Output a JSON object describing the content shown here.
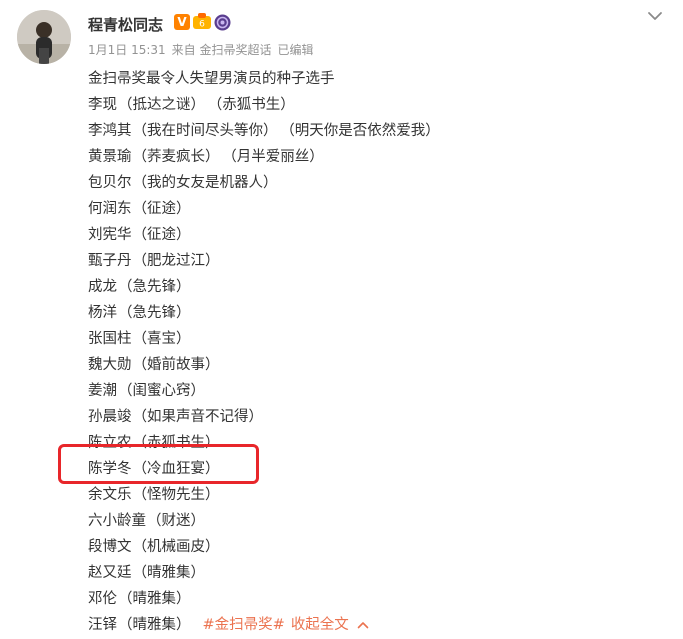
{
  "post": {
    "author": "程青松同志",
    "meta": {
      "date": "1月1日 15:31",
      "source": "来自 金扫帚奖超话",
      "edited": "已编辑"
    },
    "headline": "金扫帚奖最令人失望男演员的种子选手",
    "nominees": [
      {
        "name": "李现",
        "works": [
          "（抵达之谜）",
          "（赤狐书生）"
        ]
      },
      {
        "name": "李鸿其",
        "works": [
          "（我在时间尽头等你）",
          "（明天你是否依然爱我）"
        ]
      },
      {
        "name": "黄景瑜",
        "works": [
          "（荞麦疯长）",
          "（月半爱丽丝）"
        ]
      },
      {
        "name": "包贝尔",
        "works": [
          "（我的女友是机器人）"
        ]
      },
      {
        "name": "何润东",
        "works": [
          "（征途）"
        ]
      },
      {
        "name": "刘宪华",
        "works": [
          "（征途）"
        ]
      },
      {
        "name": "甄子丹",
        "works": [
          "（肥龙过江）"
        ]
      },
      {
        "name": "成龙",
        "works": [
          "（急先锋）"
        ]
      },
      {
        "name": "杨洋",
        "works": [
          "（急先锋）"
        ]
      },
      {
        "name": "张国柱",
        "works": [
          "（喜宝）"
        ]
      },
      {
        "name": "魏大勋",
        "works": [
          "（婚前故事）"
        ]
      },
      {
        "name": "姜潮",
        "works": [
          "（闺蜜心窍）"
        ]
      },
      {
        "name": "孙晨竣",
        "works": [
          "（如果声音不记得）"
        ]
      },
      {
        "name": "陈立农",
        "works": [
          "（赤狐书生）"
        ]
      },
      {
        "name": "陈学冬",
        "works": [
          "（冷血狂宴）"
        ]
      },
      {
        "name": "余文乐",
        "works": [
          "（怪物先生）"
        ]
      },
      {
        "name": "六小龄童",
        "works": [
          "（财迷）"
        ]
      },
      {
        "name": "段博文",
        "works": [
          "（机械画皮）"
        ]
      },
      {
        "name": "赵又廷",
        "works": [
          "（晴雅集）"
        ]
      },
      {
        "name": "邓伦",
        "works": [
          "（晴雅集）"
        ]
      }
    ],
    "last_nominee": {
      "name": "汪铎",
      "works": [
        "（晴雅集）"
      ]
    },
    "topic_tag": "#金扫帚奖#",
    "collapse_label": "收起全文"
  },
  "icons": {
    "verified": "verified-v-icon",
    "level": "level-badge-icon",
    "member": "member-badge-icon",
    "collapse": "chevron-up-icon",
    "more": "chevron-down-icon"
  },
  "colors": {
    "accent": "#eb7350",
    "verified": "#ff8200",
    "highlight": "#e8262a"
  }
}
